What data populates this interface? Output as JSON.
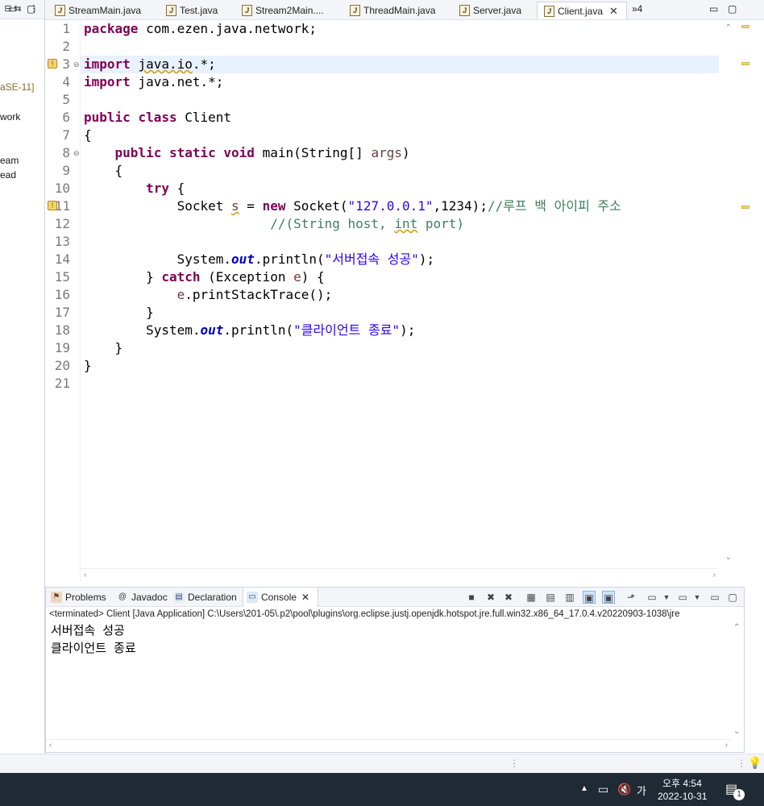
{
  "left_panel": {
    "toolbar": [
      "minimize-icon",
      "maximize-icon"
    ],
    "items": [
      "aSE-11]",
      "work",
      "eam",
      "ead"
    ]
  },
  "tabs": [
    {
      "label": "StreamMain.java",
      "active": false
    },
    {
      "label": "Test.java",
      "active": false
    },
    {
      "label": "Stream2Main....",
      "active": false
    },
    {
      "label": "ThreadMain.java",
      "active": false
    },
    {
      "label": "Server.java",
      "active": false
    },
    {
      "label": "Client.java",
      "active": true
    }
  ],
  "tab_overflow": "»4",
  "editor": {
    "line_numbers": [
      "1",
      "2",
      "3",
      "4",
      "5",
      "6",
      "7",
      "8",
      "9",
      "10",
      "11",
      "12",
      "13",
      "14",
      "15",
      "16",
      "17",
      "18",
      "19",
      "20",
      "21"
    ]
  },
  "console": {
    "tabs": [
      {
        "label": "Problems",
        "icon": "problems-icon"
      },
      {
        "label": "Javadoc",
        "icon": "at-icon"
      },
      {
        "label": "Declaration",
        "icon": "declaration-icon"
      },
      {
        "label": "Console",
        "icon": "console-icon",
        "active": true
      }
    ],
    "description": "<terminated> Client [Java Application] C:\\Users\\201-05\\.p2\\pool\\plugins\\org.eclipse.justj.openjdk.hotspot.jre.full.win32.x86_64_17.0.4.v20220903-1038\\jre",
    "output": [
      "서버접속 성공",
      "클라이언트 종료"
    ]
  },
  "taskbar": {
    "ime": "가",
    "time": "오후 4:54",
    "date": "2022-10-31",
    "notifications": "1"
  }
}
